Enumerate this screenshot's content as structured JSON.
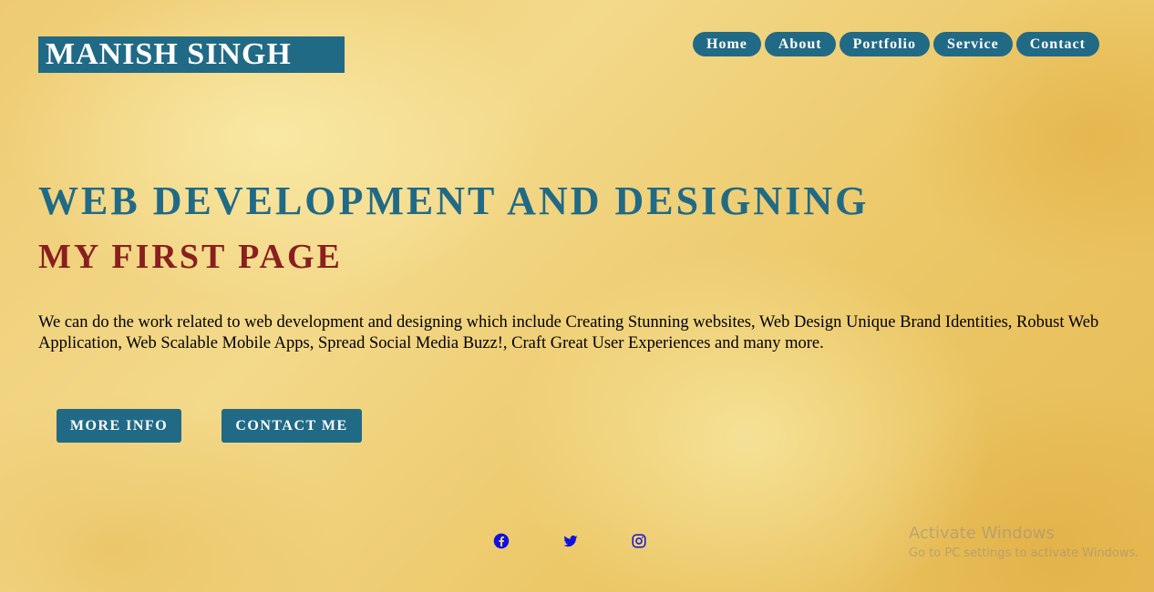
{
  "header": {
    "logo_text": "MANISH SINGH",
    "nav": [
      {
        "label": "Home"
      },
      {
        "label": "About"
      },
      {
        "label": "Portfolio"
      },
      {
        "label": "Service"
      },
      {
        "label": "Contact"
      }
    ]
  },
  "hero": {
    "headline": "WEB DEVELOPMENT AND DESIGNING",
    "subheadline": "MY FIRST PAGE",
    "description": "We can do the work related to web development and designing which include Creating Stunning websites, Web Design Unique Brand Identities, Robust Web Application, Web Scalable Mobile Apps, Spread Social Media Buzz!, Craft Great User Experiences and many more.",
    "buttons": {
      "more_info": "MORE INFO",
      "contact_me": "CONTACT ME"
    }
  },
  "social": [
    {
      "icon": "facebook-icon"
    },
    {
      "icon": "twitter-icon"
    },
    {
      "icon": "instagram-icon"
    }
  ],
  "watermark": {
    "title": "Activate Windows",
    "subtitle": "Go to PC settings to activate Windows."
  },
  "colors": {
    "primary": "#216a86",
    "accent_red": "#8a1f1f",
    "social_icons": "#1010e0"
  }
}
